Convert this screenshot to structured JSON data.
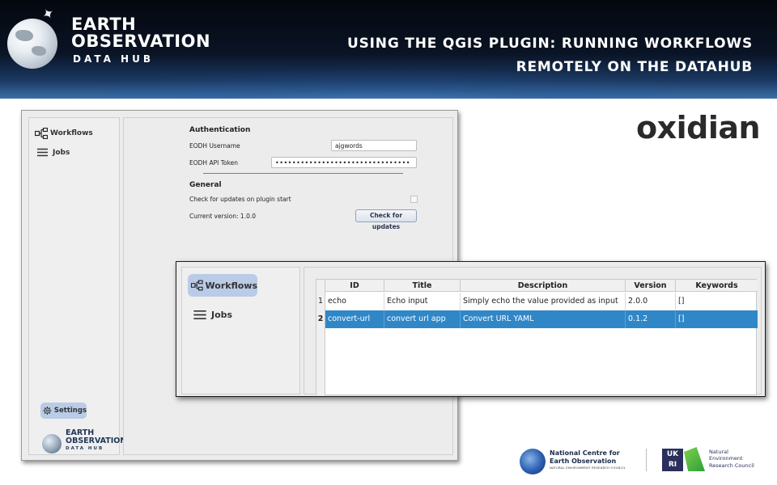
{
  "banner": {
    "brand_line1": "EARTH",
    "brand_line2": "OBSERVATION",
    "brand_line3": "DATA HUB",
    "title_line1": "USING THE QGIS PLUGIN: RUNNING WORKFLOWS",
    "title_line2": "REMOTELY ON THE DATAHUB"
  },
  "partner_logo": {
    "text": "oxidian",
    "accent_color": "#c91e2e"
  },
  "settings_window": {
    "nav": {
      "workflows": "Workflows",
      "jobs": "Jobs",
      "settings": "Settings"
    },
    "authentication": {
      "heading": "Authentication",
      "username_label": "EODH Username",
      "username_value": "ajgwords",
      "token_label": "EODH API Token",
      "token_value": "••••••••••••••••••••••••••••••••"
    },
    "general": {
      "heading": "General",
      "update_check_label": "Check for updates on plugin start",
      "version_label": "Current version: 1.0.0",
      "check_button": "Check for updates"
    },
    "mini_logo": {
      "line1": "EARTH",
      "line2": "OBSERVATION",
      "line3": "DATA HUB"
    }
  },
  "workflows_window": {
    "nav": {
      "workflows": "Workflows",
      "jobs": "Jobs"
    },
    "table": {
      "columns": [
        "ID",
        "Title",
        "Description",
        "Version",
        "Keywords"
      ],
      "rows": [
        {
          "num": "1",
          "id": "echo",
          "title": "Echo input",
          "description": "Simply echo the value provided as input",
          "version": "2.0.0",
          "keywords": "[]",
          "selected": false
        },
        {
          "num": "2",
          "id": "convert-url",
          "title": "convert url app",
          "description": "Convert URL YAML",
          "version": "0.1.2",
          "keywords": "[]",
          "selected": true
        }
      ],
      "selection_color": "#3087c8"
    }
  },
  "footer": {
    "nceo_line1": "National Centre for",
    "nceo_line2": "Earth Observation",
    "nceo_line3": "NATURAL ENVIRONMENT RESEARCH COUNCIL",
    "ukri_box": "UK RI",
    "ukri_line1": "Natural",
    "ukri_line2": "Environment",
    "ukri_line3": "Research Council"
  }
}
